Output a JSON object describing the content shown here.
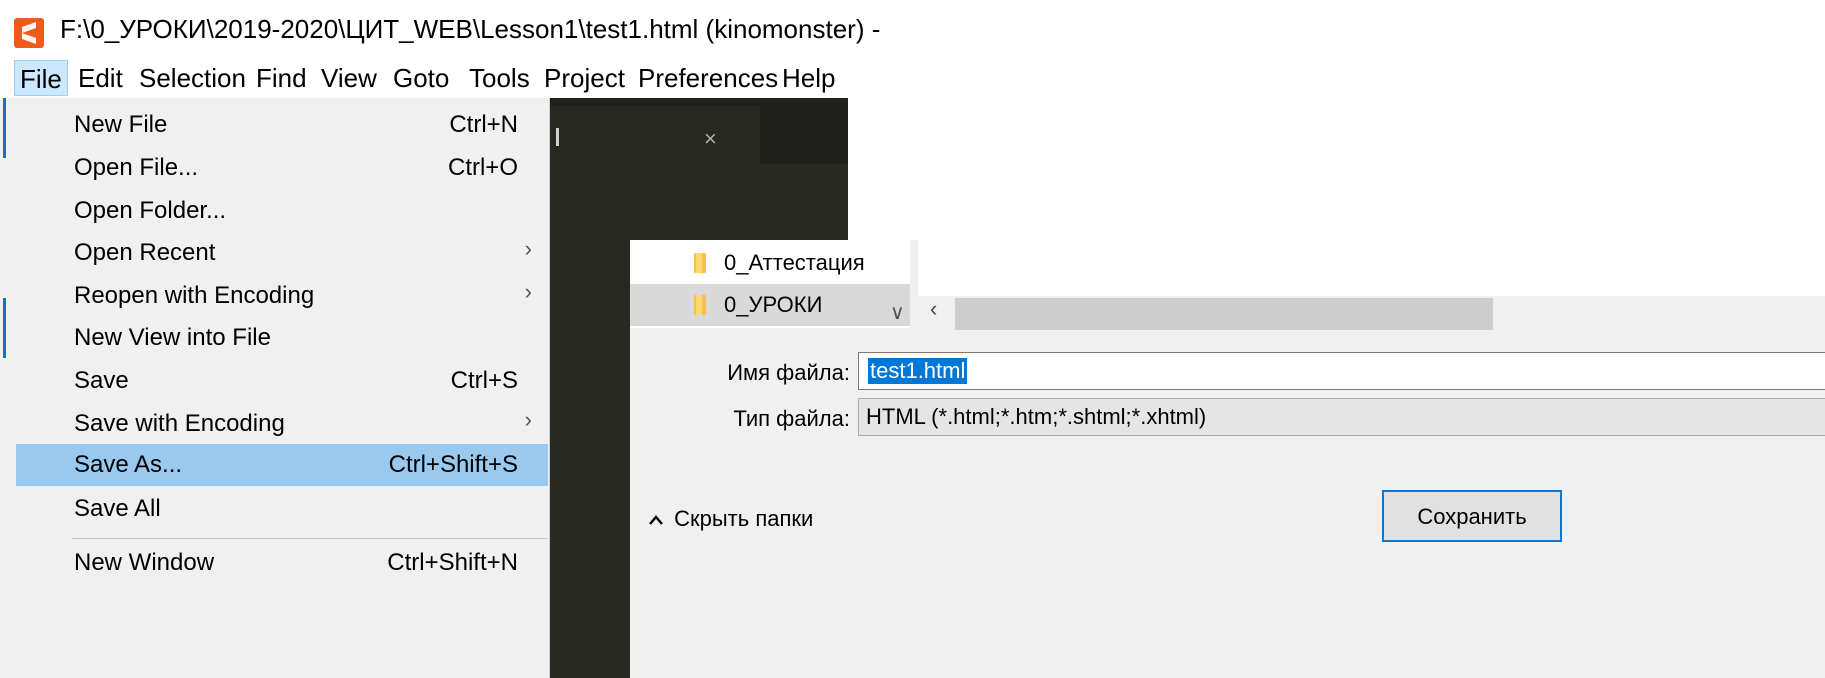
{
  "window": {
    "title": "F:\\0_УРОКИ\\2019-2020\\ЦИТ_WEB\\Lesson1\\test1.html (kinomonster) -",
    "app_icon": "sublime-text-icon"
  },
  "menubar": {
    "items": [
      "File",
      "Edit",
      "Selection",
      "Find",
      "View",
      "Goto",
      "Tools",
      "Project",
      "Preferences",
      "Help"
    ],
    "active": "File"
  },
  "file_menu": {
    "items": [
      {
        "label": "New File",
        "shortcut": "Ctrl+N"
      },
      {
        "label": "Open File...",
        "shortcut": "Ctrl+O"
      },
      {
        "label": "Open Folder...",
        "shortcut": ""
      },
      {
        "label": "Open Recent",
        "shortcut": "",
        "submenu": true
      },
      {
        "label": "Reopen with Encoding",
        "shortcut": "",
        "submenu": true
      },
      {
        "label": "New View into File",
        "shortcut": ""
      },
      {
        "label": "Save",
        "shortcut": "Ctrl+S"
      },
      {
        "label": "Save with Encoding",
        "shortcut": "",
        "submenu": true
      },
      {
        "label": "Save As...",
        "shortcut": "Ctrl+Shift+S",
        "selected": true
      },
      {
        "label": "Save All",
        "shortcut": ""
      },
      {
        "label": "New Window",
        "shortcut": "Ctrl+Shift+N"
      }
    ],
    "submenu_arrow": "›"
  },
  "editor": {
    "tab_close": "×"
  },
  "save_dialog": {
    "folders": [
      {
        "label": "0_Аттестация",
        "selected": false
      },
      {
        "label": "0_УРОКИ",
        "selected": true
      }
    ],
    "tree_chevron": "∨",
    "scroll_left": "‹",
    "filename_label": "Имя файла:",
    "filename_value": "test1.html",
    "filetype_label": "Тип файла:",
    "filetype_value": "HTML (*.html;*.htm;*.shtml;*.xhtml)",
    "hide_folders": "Скрыть папки",
    "hide_folders_caret": "^",
    "save_button": "Сохранить"
  }
}
